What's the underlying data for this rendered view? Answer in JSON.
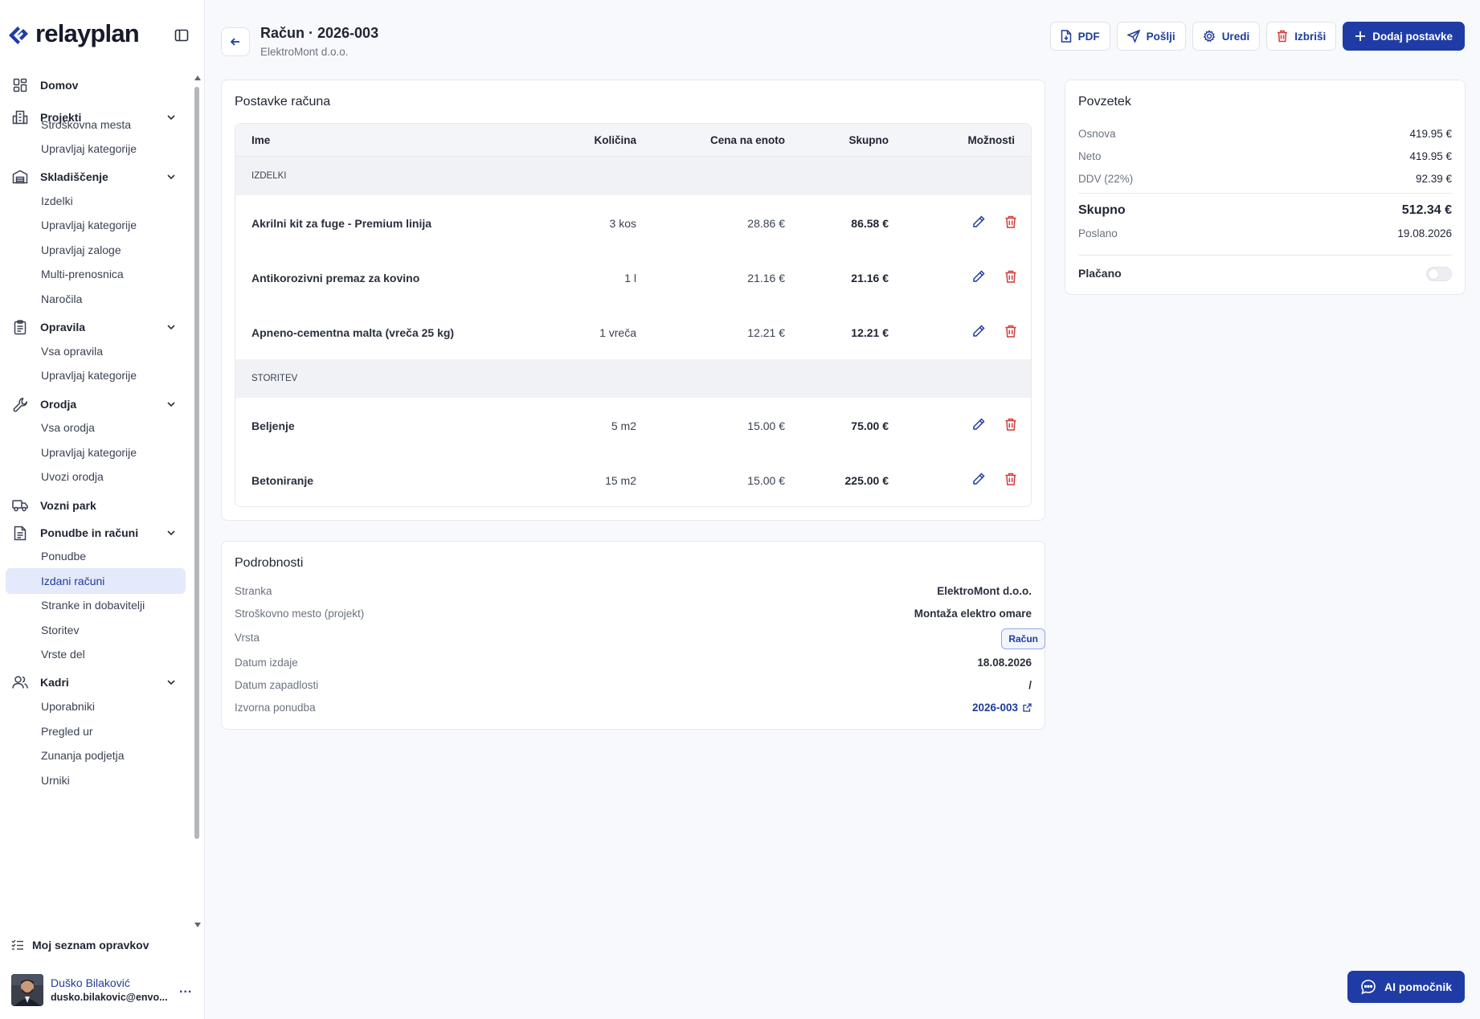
{
  "app": {
    "name": "relayplan",
    "brand_color": "#1f3ca6"
  },
  "sidebar": {
    "groups": [
      {
        "label": "Domov",
        "icon": "dashboard-icon",
        "items": []
      },
      {
        "label": "Projekti",
        "icon": "building-icon",
        "items": [
          "Stroškovna mesta",
          "Upravljaj kategorije"
        ]
      },
      {
        "label": "Skladiščenje",
        "icon": "warehouse-icon",
        "items": [
          "Izdelki",
          "Upravljaj kategorije",
          "Upravljaj zaloge",
          "Multi-prenosnica",
          "Naročila"
        ]
      },
      {
        "label": "Opravila",
        "icon": "clipboard-icon",
        "items": [
          "Vsa opravila",
          "Upravljaj kategorije"
        ]
      },
      {
        "label": "Orodja",
        "icon": "wrench-icon",
        "items": [
          "Vsa orodja",
          "Upravljaj kategorije",
          "Uvozi orodja"
        ]
      },
      {
        "label": "Vozni park",
        "icon": "truck-icon",
        "items": []
      },
      {
        "label": "Ponudbe in računi",
        "icon": "document-icon",
        "items": [
          "Ponudbe",
          "Izdani računi",
          "Stranke in dobavitelji",
          "Storitev",
          "Vrste del"
        ]
      },
      {
        "label": "Kadri",
        "icon": "users-icon",
        "items": [
          "Uporabniki",
          "Pregled ur",
          "Zunanja podjetja",
          "Urniki"
        ]
      }
    ],
    "active_item": "Izdani računi",
    "todo_link": "Moj seznam opravkov",
    "user": {
      "name": "Duško Bilaković",
      "email": "dusko.bilakovic@envo...",
      "more": "..."
    }
  },
  "header": {
    "title": "Račun · 2026-003",
    "subtitle": "ElektroMont d.o.o.",
    "actions": {
      "pdf": "PDF",
      "send": "Pošlji",
      "edit": "Uredi",
      "delete": "Izbriši",
      "add_items": "Dodaj postavke"
    }
  },
  "items_card": {
    "title": "Postavke računa",
    "columns": {
      "name": "Ime",
      "qty": "Količina",
      "unit_price": "Cena na enoto",
      "total": "Skupno",
      "options": "Možnosti"
    },
    "groups": [
      {
        "label": "IZDELKI",
        "rows": [
          {
            "name": "Akrilni kit za fuge - Premium linija",
            "qty": "3 kos",
            "unit_price": "28.86 €",
            "total": "86.58 €"
          },
          {
            "name": "Antikorozivni premaz za kovino",
            "qty": "1 l",
            "unit_price": "21.16 €",
            "total": "21.16 €"
          },
          {
            "name": "Apneno-cementna malta (vreča 25 kg)",
            "qty": "1 vreča",
            "unit_price": "12.21 €",
            "total": "12.21 €"
          }
        ]
      },
      {
        "label": "STORITEV",
        "rows": [
          {
            "name": "Beljenje",
            "qty": "5 m2",
            "unit_price": "15.00 €",
            "total": "75.00 €"
          },
          {
            "name": "Betoniranje",
            "qty": "15 m2",
            "unit_price": "15.00 €",
            "total": "225.00 €"
          }
        ]
      }
    ]
  },
  "summary": {
    "title": "Povzetek",
    "base_label": "Osnova",
    "base": "419.95 €",
    "net_label": "Neto",
    "net": "419.95 €",
    "vat_label": "DDV (22%)",
    "vat": "92.39 €",
    "total_label": "Skupno",
    "total": "512.34 €",
    "sent_label": "Poslano",
    "sent": "19.08.2026",
    "paid_label": "Plačano",
    "paid": false
  },
  "details": {
    "title": "Podrobnosti",
    "client_label": "Stranka",
    "client": "ElektroMont d.o.o.",
    "cost_center_label": "Stroškovno mesto (projekt)",
    "cost_center": "Montaža elektro omare",
    "type_label": "Vrsta",
    "type": "Račun",
    "issue_date_label": "Datum izdaje",
    "issue_date": "18.08.2026",
    "due_date_label": "Datum zapadlosti",
    "due_date": "/",
    "source_offer_label": "Izvorna ponudba",
    "source_offer": "2026-003"
  },
  "ai_button": "AI pomočnik"
}
